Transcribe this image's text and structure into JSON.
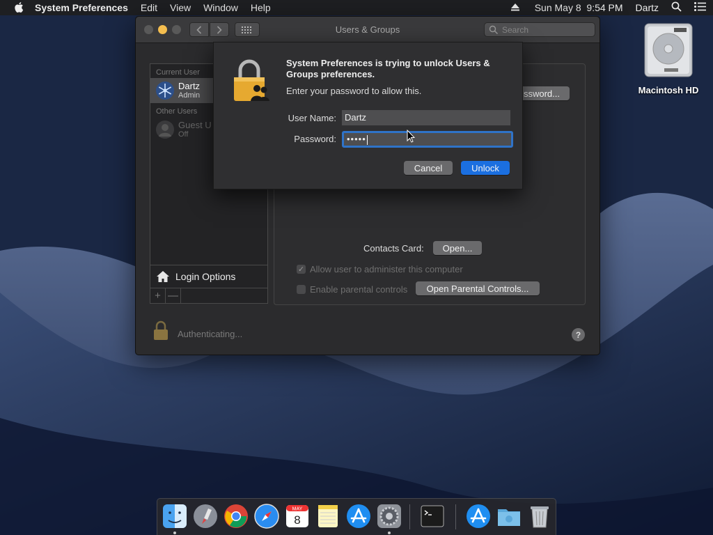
{
  "menubar": {
    "app_name": "System Preferences",
    "menus": [
      "Edit",
      "View",
      "Window",
      "Help"
    ],
    "clock": "Sun May 8  9:54 PM",
    "user": "Dartz"
  },
  "desktop": {
    "hd_label": "Macintosh HD"
  },
  "window": {
    "title": "Users & Groups",
    "search_placeholder": "Search",
    "sidebar": {
      "current_user_header": "Current User",
      "current_user": {
        "name": "Dartz",
        "role": "Admin"
      },
      "other_users_header": "Other Users",
      "guest_user": {
        "name": "Guest U",
        "role": "Off"
      },
      "login_options_label": "Login Options",
      "add_label": "+",
      "remove_label": "—"
    },
    "panel": {
      "password_button_partial": "ssword...",
      "contacts_card_label": "Contacts Card:",
      "open_button": "Open...",
      "allow_admin_label": "Allow user to administer this computer",
      "parental_controls_label": "Enable parental controls",
      "open_parental_button": "Open Parental Controls..."
    },
    "status_text": "Authenticating...",
    "help_label": "?"
  },
  "dialog": {
    "heading": "System Preferences is trying to unlock Users & Groups preferences.",
    "subtext": "Enter your password to allow this.",
    "username_label": "User Name:",
    "username_value": "Dartz",
    "password_label": "Password:",
    "password_value": "•••••",
    "cancel_button": "Cancel",
    "unlock_button": "Unlock"
  },
  "dock": {
    "calendar_month": "MAY",
    "calendar_day": "8",
    "apps": [
      "finder-icon",
      "launchpad-icon",
      "chrome-icon",
      "safari-icon",
      "calendar-icon",
      "notes-icon",
      "app-store-icon",
      "system-preferences-icon",
      "terminal-icon",
      "applications-folder-icon",
      "downloads-folder-icon",
      "trash-icon"
    ]
  },
  "colors": {
    "accent": "#1b6fe0",
    "focus_ring": "#2f73c8",
    "window_bg": "#2b2b2d",
    "minimize": "#f5be4f"
  }
}
